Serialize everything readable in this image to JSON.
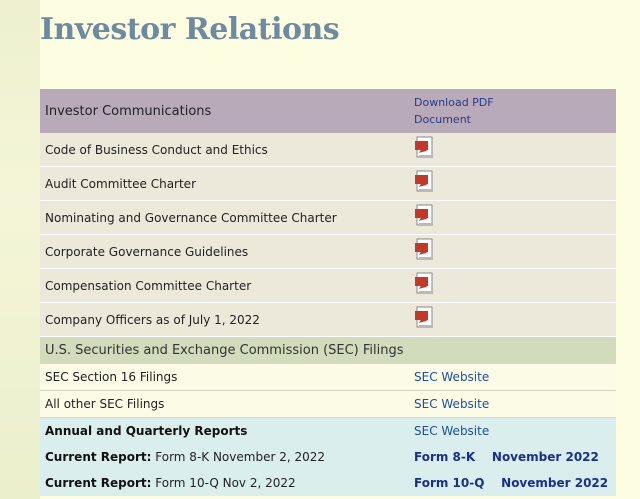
{
  "page": {
    "title": "Investor Relations"
  },
  "table_header": {
    "left": "Investor Communications",
    "right_line1": "Download PDF",
    "right_line2": "Document"
  },
  "documents": [
    {
      "label": "Code of Business Conduct and Ethics",
      "icon": "pdf-icon"
    },
    {
      "label": "Audit Committee Charter",
      "icon": "pdf-icon"
    },
    {
      "label": "Nominating and Governance Committee Charter",
      "icon": "pdf-icon"
    },
    {
      "label": "Corporate Governance Guidelines",
      "icon": "pdf-icon"
    },
    {
      "label": "Compensation Committee Charter",
      "icon": "pdf-icon"
    },
    {
      "label": "Company Officers as of July 1, 2022",
      "icon": "pdf-icon"
    }
  ],
  "sec_section": {
    "heading": "U.S. Securities and Exchange Commission (SEC) Filings",
    "rows": [
      {
        "label": "SEC Section 16 Filings",
        "link": "SEC Website"
      },
      {
        "label": "All other SEC Filings",
        "link": "SEC Website"
      }
    ]
  },
  "reports": {
    "heading": "Annual and Quarterly Reports",
    "heading_link": "SEC Website",
    "items": [
      {
        "prefix": "Current Report:",
        "text": " Form 8-K November 2, 2022",
        "link": "Form 8-K    November 2022"
      },
      {
        "prefix": "Current Report:",
        "text": " Form 10-Q Nov 2, 2022",
        "link": "Form 10-Q    November 2022"
      }
    ]
  },
  "colors": {
    "header_bg": "#b9aab9",
    "doc_row_bg": "#ece8da",
    "sec_heading_bg": "#d2dbbb",
    "reports_bg": "#daeeed",
    "link": "#1d4f9e",
    "title": "#6e8aa0"
  }
}
